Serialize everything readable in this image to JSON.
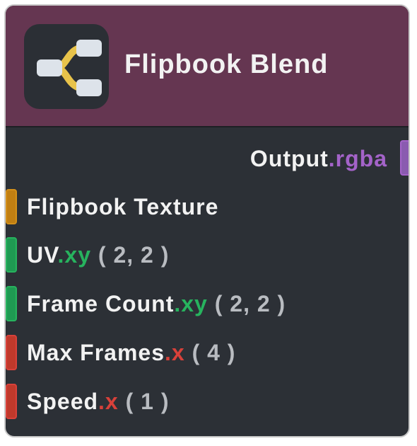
{
  "node": {
    "title": "Flipbook Blend",
    "icon": "branch-node-icon",
    "colors": {
      "header": "#653651",
      "body": "#2c3036",
      "text": "#f2f2f2",
      "default_value": "#b9bcc1"
    }
  },
  "output": {
    "name": "Output",
    "swizzle": ".rgba",
    "swizzle_color": "#a463c9",
    "port_color": "#8a5bb0"
  },
  "inputs": [
    {
      "name": "Flipbook Texture",
      "swizzle": "",
      "default": "",
      "swizzle_color": "#d4901a",
      "port_color": "#c17f12"
    },
    {
      "name": "UV",
      "swizzle": ".xy",
      "default": "( 2, 2 )",
      "swizzle_color": "#27b35e",
      "port_color": "#1f9a52"
    },
    {
      "name": "Frame Count",
      "swizzle": ".xy",
      "default": "( 2, 2 )",
      "swizzle_color": "#27b35e",
      "port_color": "#1f9a52"
    },
    {
      "name": "Max Frames",
      "swizzle": ".x",
      "default": "( 4 )",
      "swizzle_color": "#d8413a",
      "port_color": "#c0392b"
    },
    {
      "name": "Speed",
      "swizzle": ".x",
      "default": "( 1 )",
      "swizzle_color": "#d8413a",
      "port_color": "#c0392b"
    }
  ]
}
